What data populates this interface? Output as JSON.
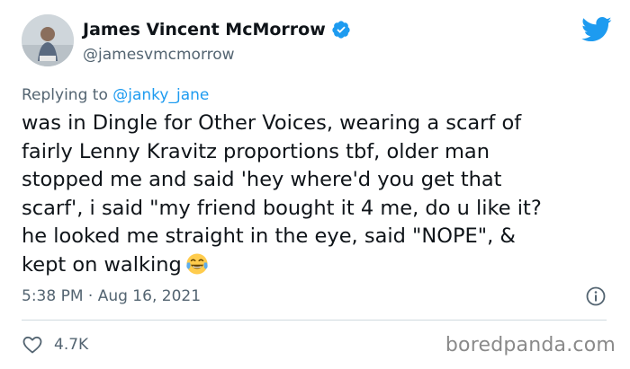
{
  "author": {
    "display_name": "James Vincent McMorrow",
    "handle": "@jamesvmcmorrow",
    "avatar_icon": "person-avatar",
    "verified_icon": "verified-badge-icon"
  },
  "reply": {
    "prefix": "Replying to ",
    "target": "@janky_jane"
  },
  "tweet": {
    "lines": [
      "was in Dingle for Other Voices, wearing a scarf of",
      "fairly Lenny Kravitz proportions tbf, older man",
      "stopped me and said 'hey where'd you get that",
      "scarf', i said \"my friend bought it 4 me, do u like it?",
      "he looked me straight in the eye, said \"NOPE\", &",
      "kept on walking"
    ],
    "emoji": "face-with-tears-of-joy-emoji"
  },
  "meta": {
    "timestamp": "5:38 PM · Aug 16, 2021",
    "likes": "4.7K"
  },
  "watermark": "boredpanda.com",
  "icons": {
    "bird": "twitter-bird-icon",
    "info": "info-icon",
    "heart": "heart-icon"
  },
  "colors": {
    "twitter_blue": "#1d9bf0",
    "text_primary": "#0f1419",
    "text_secondary": "#536471",
    "divider": "#cfd9de"
  }
}
